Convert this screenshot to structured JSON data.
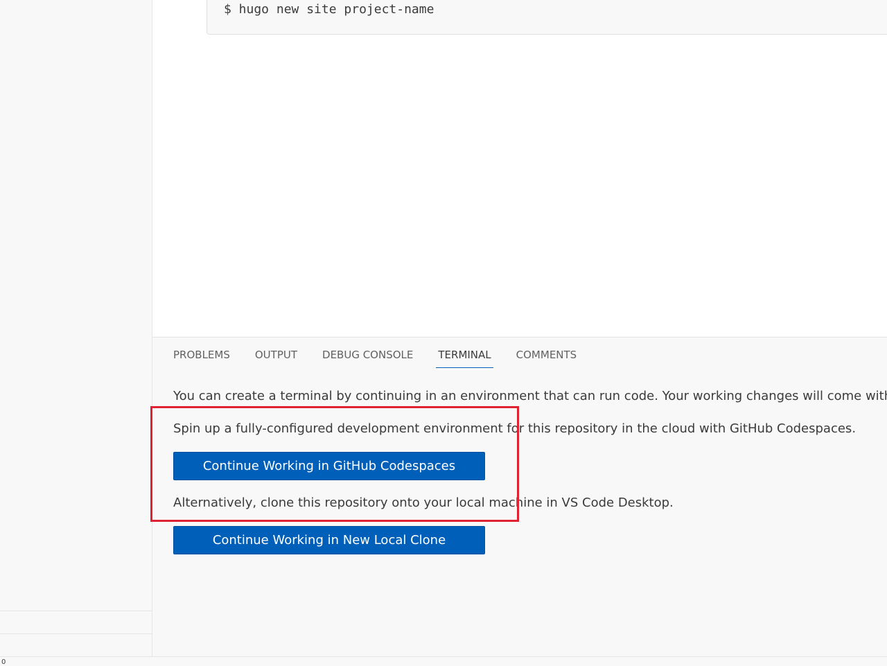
{
  "editor": {
    "code_line": "$ hugo new site project-name"
  },
  "panel": {
    "tabs": [
      {
        "label": "PROBLEMS",
        "active": false
      },
      {
        "label": "OUTPUT",
        "active": false
      },
      {
        "label": "DEBUG CONSOLE",
        "active": false
      },
      {
        "label": "TERMINAL",
        "active": true
      },
      {
        "label": "COMMENTS",
        "active": false
      }
    ],
    "terminal_message": "You can create a terminal by continuing in an environment that can run code. Your working changes will come with you as",
    "codespaces_message": "Spin up a fully-configured development environment for this repository in the cloud with GitHub Codespaces.",
    "codespaces_button": "Continue Working in GitHub Codespaces",
    "local_message": "Alternatively, clone this repository onto your local machine in VS Code Desktop.",
    "local_button": "Continue Working in New Local Clone"
  },
  "statusbar": {
    "text": "0"
  },
  "colors": {
    "accent": "#005fb8",
    "highlight": "#e02131"
  }
}
